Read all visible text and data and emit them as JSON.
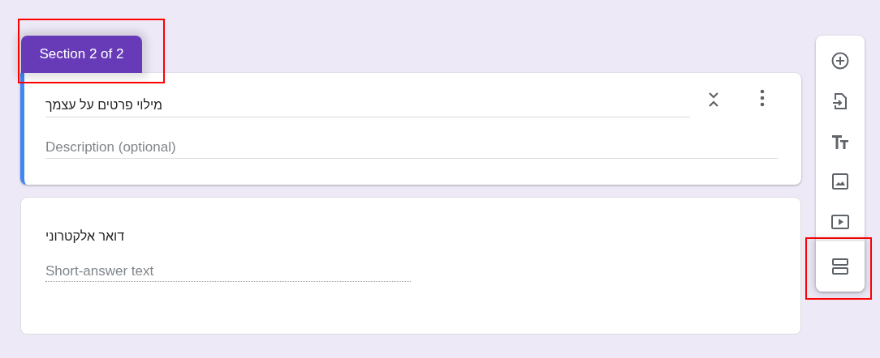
{
  "section_tab": {
    "label": "Section 2 of 2",
    "highlighted": true
  },
  "section_header": {
    "title": "מילוי פרטים על עצמך",
    "description_placeholder": "Description (optional)"
  },
  "question": {
    "title": "דואר אלקטרוני",
    "placeholder": "Short-answer text"
  },
  "toolbar": [
    {
      "kind": "add-question",
      "highlighted": false
    },
    {
      "kind": "import",
      "highlighted": false
    },
    {
      "kind": "title",
      "highlighted": false
    },
    {
      "kind": "image",
      "highlighted": false
    },
    {
      "kind": "video",
      "highlighted": false
    },
    {
      "kind": "section",
      "highlighted": true
    }
  ]
}
